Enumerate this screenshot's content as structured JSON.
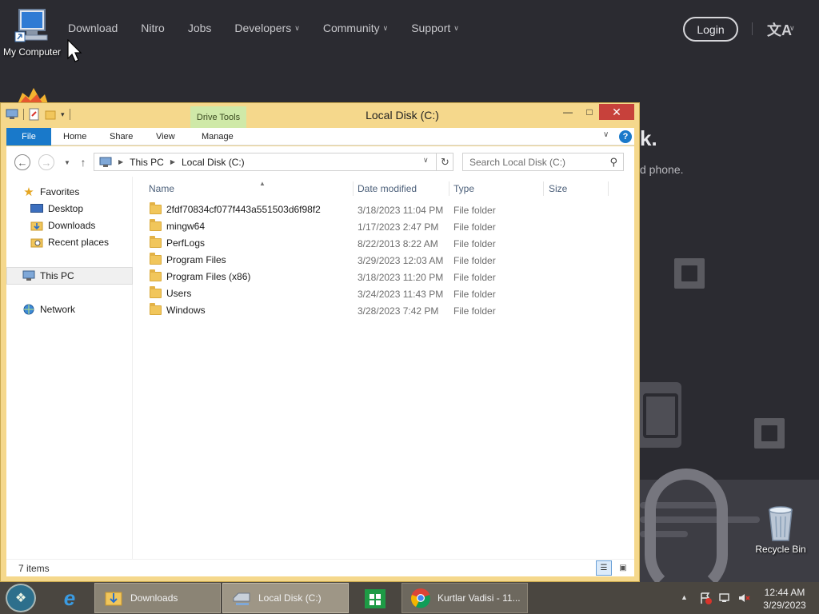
{
  "site": {
    "nav": [
      {
        "label": "Download",
        "has_menu": false
      },
      {
        "label": "Nitro",
        "has_menu": false
      },
      {
        "label": "Jobs",
        "has_menu": false
      },
      {
        "label": "Developers",
        "has_menu": true
      },
      {
        "label": "Community",
        "has_menu": true
      },
      {
        "label": "Support",
        "has_menu": true
      }
    ],
    "login_label": "Login",
    "language_icon": "translate-icon",
    "hero_fragment": "k.",
    "hero_text_fragment": "d phone."
  },
  "desktop": {
    "my_computer_label": "My Computer",
    "recycle_bin_label": "Recycle Bin"
  },
  "explorer": {
    "title": "Local Disk (C:)",
    "contextual_tab_group": "Drive Tools",
    "ribbon_tabs": {
      "file": "File",
      "home": "Home",
      "share": "Share",
      "view": "View",
      "manage": "Manage"
    },
    "address": {
      "crumbs": [
        "This PC",
        "Local Disk (C:)"
      ]
    },
    "search_placeholder": "Search Local Disk (C:)",
    "nav_pane": {
      "favorites": "Favorites",
      "desktop": "Desktop",
      "downloads": "Downloads",
      "recent_places": "Recent places",
      "this_pc": "This PC",
      "network": "Network"
    },
    "columns": {
      "name": "Name",
      "date_modified": "Date modified",
      "type": "Type",
      "size": "Size"
    },
    "files": [
      {
        "name": "2fdf70834cf077f443a551503d6f98f2",
        "date": "3/18/2023 11:04 PM",
        "type": "File folder"
      },
      {
        "name": "mingw64",
        "date": "1/17/2023 2:47 PM",
        "type": "File folder"
      },
      {
        "name": "PerfLogs",
        "date": "8/22/2013 8:22 AM",
        "type": "File folder"
      },
      {
        "name": "Program Files",
        "date": "3/29/2023 12:03 AM",
        "type": "File folder"
      },
      {
        "name": "Program Files (x86)",
        "date": "3/18/2023 11:20 PM",
        "type": "File folder"
      },
      {
        "name": "Users",
        "date": "3/24/2023 11:43 PM",
        "type": "File folder"
      },
      {
        "name": "Windows",
        "date": "3/28/2023 7:42 PM",
        "type": "File folder"
      }
    ],
    "status": "7 items"
  },
  "taskbar": {
    "downloads_label": "Downloads",
    "local_disk_label": "Local Disk (C:)",
    "chrome_label": "Kurtlar Vadisi - 11...",
    "time": "12:44 AM",
    "date": "3/29/2023"
  },
  "colors": {
    "window_frame": "#f5d88c",
    "file_tab": "#1979ca",
    "close_button": "#c7413b",
    "drive_tools": "#cfe9a8",
    "site_background": "#2b2b31",
    "taskbar": "#4a4640"
  }
}
